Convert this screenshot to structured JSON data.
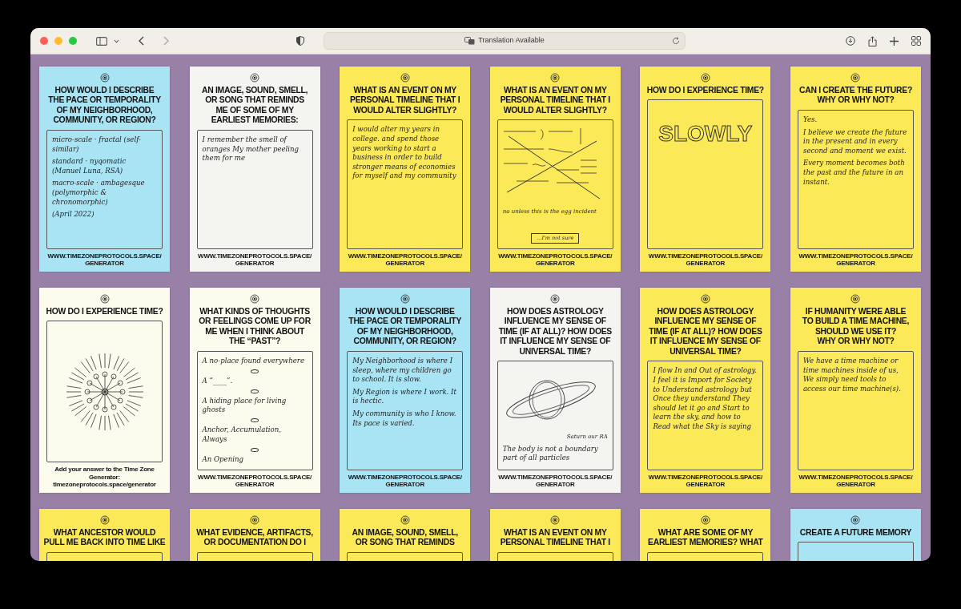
{
  "browser": {
    "address": "Translation Available"
  },
  "cards": [
    {
      "color": "#a8e4f4",
      "kind": "text",
      "heading": [
        "HOW WOULD I DESCRIBE",
        "THE PACE OR TEMPORALITY",
        "OF MY NEIGHBORHOOD,",
        "COMMUNITY, OR REGION?"
      ],
      "answer": [
        "micro-scale · fractal (self-similar)",
        "standard · nyqomatic (Manuel Luna, RSA)",
        "macro-scale · ambagesque (polymorphic & chronomorphic)",
        "(April 2022)"
      ],
      "footer": [
        "WWW.TIMEZONEPROTOCOLS.SPACE/GENERATOR"
      ]
    },
    {
      "color": "#f4f4f1",
      "kind": "text",
      "heading": [
        "AN IMAGE, SOUND, SMELL,",
        "OR SONG THAT REMINDS",
        "ME OF SOME OF MY",
        "EARLIEST MEMORIES:"
      ],
      "answer": [
        "I remember the smell of oranges My mother peeling them for me"
      ],
      "footer": [
        "WWW.TIMEZONEPROTOCOLS.SPACE/GENERATOR"
      ]
    },
    {
      "color": "#fce957",
      "kind": "text",
      "heading": [
        "WHAT IS AN EVENT ON MY",
        "PERSONAL TIMELINE THAT I",
        "WOULD ALTER SLIGHTLY?"
      ],
      "answer": [
        "I would alter my years in college. and spend those years working to start a business in order to build stronger means of economies for myself and my community"
      ],
      "footer": [
        "WWW.TIMEZONEPROTOCOLS.SPACE/GENERATOR"
      ]
    },
    {
      "color": "#fce957",
      "kind": "math",
      "heading": [
        "WHAT IS AN EVENT ON MY",
        "PERSONAL TIMELINE THAT I",
        "WOULD ALTER SLIGHTLY?"
      ],
      "answer": [
        "no unless this is the egg incident",
        "...I'm not sure"
      ],
      "footer": [
        "WWW.TIMEZONEPROTOCOLS.SPACE/GENERATOR"
      ]
    },
    {
      "color": "#fce957",
      "kind": "lettering",
      "heading": [
        "HOW DO I EXPERIENCE TIME?"
      ],
      "answer": [
        "SLOWLY"
      ],
      "footer": [
        "WWW.TIMEZONEPROTOCOLS.SPACE/GENERATOR"
      ]
    },
    {
      "color": "#fce957",
      "kind": "text",
      "heading": [
        "CAN I CREATE THE FUTURE?",
        "WHY OR WHY NOT?"
      ],
      "answer": [
        "Yes.",
        "I believe we create the future in the present and in every second and moment we exist.",
        "Every moment becomes both the past and the future in an instant."
      ],
      "footer": [
        "WWW.TIMEZONEPROTOCOLS.SPACE/GENERATOR"
      ]
    },
    {
      "color": "#fbfbee",
      "kind": "starburst",
      "heading": [
        "HOW DO I EXPERIENCE TIME?"
      ],
      "footer": [
        "Add your answer to the Time Zone Generator:",
        "timezoneprotocols.space/generator"
      ]
    },
    {
      "color": "#fbfbee",
      "kind": "chain",
      "heading": [
        "WHAT KINDS OF THOUGHTS",
        "OR FEELINGS COME UP FOR",
        "ME WHEN I THINK ABOUT",
        "THE “PAST”?"
      ],
      "answer": [
        "A no-place found everywhere",
        "A “____”.",
        "A hiding place for living ghosts",
        "Anchor, Accumulation, Always",
        "An Opening"
      ],
      "footer": [
        "WWW.TIMEZONEPROTOCOLS.SPACE/GENERATOR"
      ]
    },
    {
      "color": "#a8e4f4",
      "kind": "text",
      "heading": [
        "HOW WOULD I DESCRIBE",
        "THE PACE OR TEMPORALITY",
        "OF MY NEIGHBORHOOD,",
        "COMMUNITY, OR REGION?"
      ],
      "answer": [
        "My Neighborhood is where I sleep, where my children go to school. It is slow.",
        "My Region is where I work. It is hectic.",
        "My community is who I know. Its pace is varied."
      ],
      "footer": [
        "WWW.TIMEZONEPROTOCOLS.SPACE/GENERATOR"
      ]
    },
    {
      "color": "#f4f4f1",
      "kind": "saturn",
      "heading": [
        "HOW DOES ASTROLOGY",
        "INFLUENCE MY SENSE OF",
        "TIME (IF AT ALL)? HOW DOES",
        "IT INFLUENCE MY SENSE OF",
        "UNIVERSAL TIME?"
      ],
      "answer": [
        "Saturn our RA",
        "The body is not a boundary part of all particles"
      ],
      "footer": [
        "WWW.TIMEZONEPROTOCOLS.SPACE/GENERATOR"
      ]
    },
    {
      "color": "#fce957",
      "kind": "text",
      "heading": [
        "HOW DOES ASTROLOGY",
        "INFLUENCE MY SENSE OF",
        "TIME (IF AT ALL)? HOW DOES",
        "IT INFLUENCE MY SENSE OF",
        "UNIVERSAL TIME?"
      ],
      "answer": [
        "I flow In and Out of astrology. I feel it is Import for Society to Understand astrology but Once they understand They should let it go and Start to learn the sky, and how to Read what the Sky is saying"
      ],
      "footer": [
        "WWW.TIMEZONEPROTOCOLS.SPACE/GENERATOR"
      ]
    },
    {
      "color": "#fce957",
      "kind": "text",
      "heading": [
        "IF HUMANITY WERE ABLE",
        "TO BUILD A TIME MACHINE,",
        "SHOULD WE USE IT?",
        "WHY OR WHY NOT?"
      ],
      "answer": [
        "We have a time machine or time machines inside of us, We simply need tools to access our time machine(s)."
      ],
      "footer": [
        "WWW.TIMEZONEPROTOCOLS.SPACE/GENERATOR"
      ]
    },
    {
      "color": "#fce957",
      "kind": "text",
      "heading": [
        "WHAT ANCESTOR WOULD",
        "PULL ME BACK INTO TIME LIKE"
      ]
    },
    {
      "color": "#fce957",
      "kind": "text",
      "heading": [
        "WHAT EVIDENCE, ARTIFACTS,",
        "OR DOCUMENTATION DO I"
      ]
    },
    {
      "color": "#fce957",
      "kind": "text",
      "heading": [
        "AN IMAGE, SOUND, SMELL,",
        "OR SONG THAT REMINDS"
      ]
    },
    {
      "color": "#fce957",
      "kind": "text",
      "heading": [
        "WHAT IS AN EVENT ON MY",
        "PERSONAL TIMELINE THAT I"
      ]
    },
    {
      "color": "#fce957",
      "kind": "text",
      "heading": [
        "WHAT ARE SOME OF MY",
        "EARLIEST MEMORIES? WHAT"
      ]
    },
    {
      "color": "#a8e4f4",
      "kind": "text",
      "heading": [
        "CREATE A FUTURE MEMORY"
      ]
    }
  ]
}
